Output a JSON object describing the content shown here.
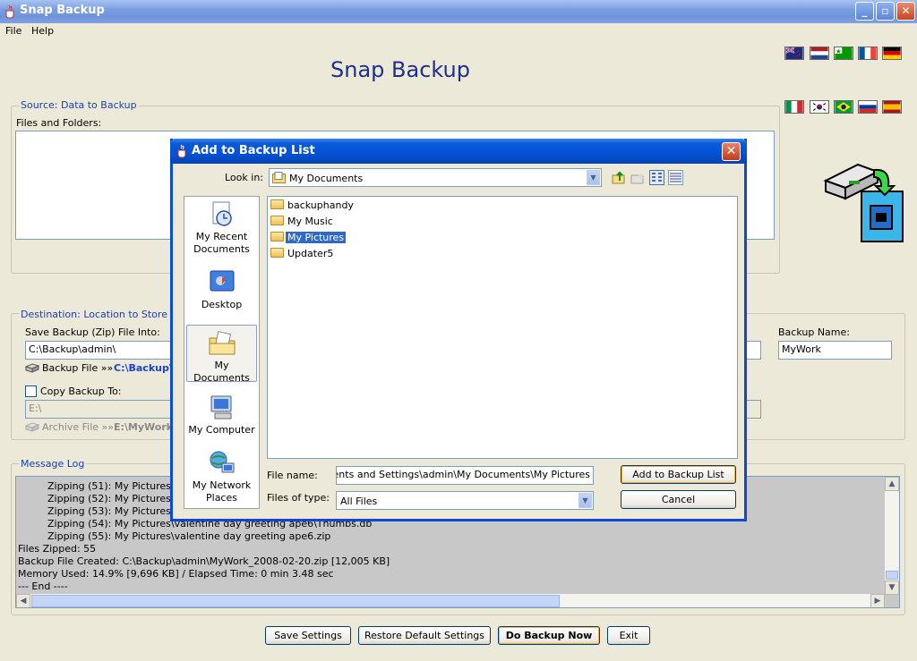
{
  "window": {
    "title": "Snap Backup"
  },
  "menu": {
    "file": "File",
    "help": "Help"
  },
  "app_heading": "Snap Backup",
  "flags_row1": [
    "nz-flag",
    "netherlands-flag",
    "esperanto-flag",
    "france-flag",
    "germany-flag"
  ],
  "flags_row2": [
    "italy-flag",
    "korea-flag",
    "brazil-flag",
    "russia-flag",
    "spain-flag"
  ],
  "source": {
    "title": "Source: Data to Backup",
    "files_label": "Files and Folders:"
  },
  "destination": {
    "title": "Destination: Location to Store Backup",
    "save_label": "Save Backup (Zip) File Into:",
    "save_value": "C:\\Backup\\admin\\",
    "backup_file_label": "Backup File »»",
    "backup_file_value": "C:\\Backup\\",
    "backup_name_label": "Backup Name:",
    "backup_name_value": "MyWork",
    "copy_label": "Copy Backup To:",
    "copy_value": "E:\\",
    "archive_label": "Archive File »»",
    "archive_value": "E:\\MyWork"
  },
  "log": {
    "title": "Message Log",
    "lines": [
      "Zipping (51): My Pictures\\va",
      "Zipping (52): My Pictures\\va",
      "Zipping (53): My Pictures\\va",
      "Zipping (54): My Pictures\\valentine day greeting ape6\\Thumbs.db",
      "Zipping (55): My Pictures\\valentine day greeting ape6.zip",
      "Files Zipped: 55",
      "Backup File Created: C:\\Backup\\admin\\MyWork_2008-02-20.zip  [12,005 KB]",
      "Memory Used: 14.9%  [9,696 KB]  /  Elapsed Time: 0 min 3.48 sec",
      "--- End ----"
    ]
  },
  "buttons": {
    "save_settings": "Save Settings",
    "restore_defaults": "Restore Default Settings",
    "do_backup": "Do Backup Now",
    "exit": "Exit"
  },
  "dialog": {
    "title": "Add to Backup List",
    "look_in_label": "Look in:",
    "look_in_value": "My Documents",
    "places": [
      "My Recent Documents",
      "Desktop",
      "My Documents",
      "My Computer",
      "My Network Places"
    ],
    "files": [
      "backuphandy",
      "My Music",
      "My Pictures",
      "Updater5"
    ],
    "file_name_label": "File name:",
    "file_name_value": "Documents and Settings\\admin\\My Documents\\My Pictures",
    "files_of_type_label": "Files of type:",
    "files_of_type_value": "All Files",
    "add_button": "Add to Backup List",
    "cancel_button": "Cancel"
  }
}
